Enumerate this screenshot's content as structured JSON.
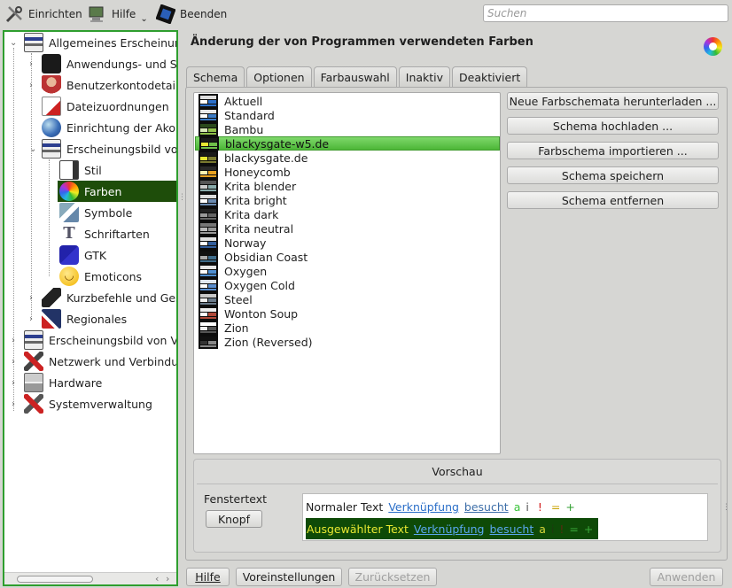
{
  "toolbar": {
    "configure_label": "Einrichten",
    "help_label": "Hilfe",
    "quit_label": "Beenden",
    "search_placeholder": "Suchen"
  },
  "sidebar": {
    "items": [
      {
        "label": "Allgemeines Erscheinungsbild",
        "level": 0,
        "arrow": "v"
      },
      {
        "label": "Anwendungs- und Systembenachrichtigungen",
        "level": 1,
        "arrow": ">"
      },
      {
        "label": "Benutzerkontodetails",
        "level": 1,
        "arrow": ">"
      },
      {
        "label": "Dateizuordnungen",
        "level": 1,
        "arrow": ""
      },
      {
        "label": "Einrichtung der Akonadi-Dienste",
        "level": 1,
        "arrow": ""
      },
      {
        "label": "Erscheinungsbild von Anwendungen",
        "level": 1,
        "arrow": "v"
      },
      {
        "label": "Stil",
        "level": 2,
        "arrow": ""
      },
      {
        "label": "Farben",
        "level": 2,
        "arrow": "",
        "selected": true
      },
      {
        "label": "Symbole",
        "level": 2,
        "arrow": ""
      },
      {
        "label": "Schriftarten",
        "level": 2,
        "arrow": ""
      },
      {
        "label": "GTK",
        "level": 2,
        "arrow": ""
      },
      {
        "label": "Emoticons",
        "level": 2,
        "arrow": ""
      },
      {
        "label": "Kurzbefehle und Gesten",
        "level": 1,
        "arrow": ">"
      },
      {
        "label": "Regionales",
        "level": 1,
        "arrow": ">"
      },
      {
        "label": "Erscheinungsbild von Verhalten",
        "level": 0,
        "arrow": ">"
      },
      {
        "label": "Netzwerk und Verbindungen",
        "level": 0,
        "arrow": ">"
      },
      {
        "label": "Hardware",
        "level": 0,
        "arrow": ">"
      },
      {
        "label": "Systemverwaltung",
        "level": 0,
        "arrow": ">"
      }
    ]
  },
  "main": {
    "title": "Änderung der von Programmen verwendeten Farben",
    "tabs": [
      {
        "label": "Schema",
        "active": true
      },
      {
        "label": "Optionen"
      },
      {
        "label": "Farbauswahl"
      },
      {
        "label": "Inaktiv"
      },
      {
        "label": "Deaktiviert"
      }
    ],
    "schemes": [
      "Aktuell",
      "Standard",
      "Bambu",
      "blackysgate-w5.de",
      "blackysgate.de",
      "Honeycomb",
      "Krita blender",
      "Krita bright",
      "Krita dark",
      "Krita neutral",
      "Norway",
      "Obsidian Coast",
      "Oxygen",
      "Oxygen Cold",
      "Steel",
      "Wonton Soup",
      "Zion",
      "Zion (Reversed)"
    ],
    "selected_scheme": "blackysgate-w5.de",
    "buttons": {
      "download": "Neue Farbschemata herunterladen ...",
      "upload": "Schema hochladen ...",
      "import": "Farbschema importieren ...",
      "save": "Schema speichern",
      "remove": "Schema entfernen"
    },
    "preview": {
      "title": "Vorschau",
      "window_text_label": "Fenstertext",
      "button_label": "Knopf",
      "normal_text": "Normaler Text",
      "selected_text": "Ausgewählter Text",
      "link": "Verknüpfung",
      "visited": "besucht",
      "active": "a",
      "inactive": "i",
      "negative": "!",
      "neutral": "=",
      "positive": "+"
    }
  },
  "footer": {
    "help": "Hilfe",
    "defaults": "Voreinstellungen",
    "reset": "Zurücksetzen",
    "apply": "Anwenden"
  },
  "colors": {
    "selection_green": "#1e4d0a",
    "list_selection": "#62c84e",
    "preview_selection_bg": "#0e4a07",
    "preview_selection_fg": "#e8e832"
  }
}
